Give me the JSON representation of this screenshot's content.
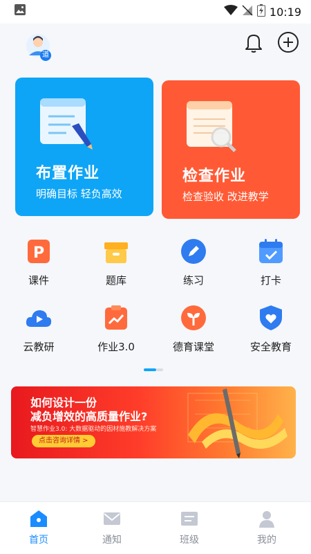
{
  "status_bar": {
    "time": "10:19"
  },
  "header": {
    "avatar_badge": "道"
  },
  "cards": {
    "assign": {
      "title": "布置作业",
      "subtitle": "明确目标 轻负高效"
    },
    "check": {
      "title": "检查作业",
      "subtitle": "检查验收 改进教学"
    }
  },
  "grid": [
    {
      "label": "课件",
      "icon": "courseware-icon"
    },
    {
      "label": "题库",
      "icon": "question-bank-icon"
    },
    {
      "label": "练习",
      "icon": "practice-icon"
    },
    {
      "label": "打卡",
      "icon": "checkin-icon"
    },
    {
      "label": "云教研",
      "icon": "cloud-research-icon"
    },
    {
      "label": "作业3.0",
      "icon": "homework-3-icon"
    },
    {
      "label": "德育课堂",
      "icon": "moral-class-icon"
    },
    {
      "label": "安全教育",
      "icon": "safety-education-icon"
    }
  ],
  "banner": {
    "title_line1": "如何设计一份",
    "title_line2": "减负增效的高质量作业?",
    "subtitle": "智慧作业3.0: 大数据驱动的因材施教解决方案",
    "button": "点击咨询详情 >"
  },
  "bottom_nav": [
    {
      "label": "首页",
      "icon": "home-icon",
      "active": true
    },
    {
      "label": "通知",
      "icon": "mail-icon",
      "active": false
    },
    {
      "label": "班级",
      "icon": "class-icon",
      "active": false
    },
    {
      "label": "我的",
      "icon": "profile-icon",
      "active": false
    }
  ],
  "colors": {
    "assign_card": "#0fa5f6",
    "check_card": "#ff5a35",
    "active_nav": "#1a8cff"
  }
}
